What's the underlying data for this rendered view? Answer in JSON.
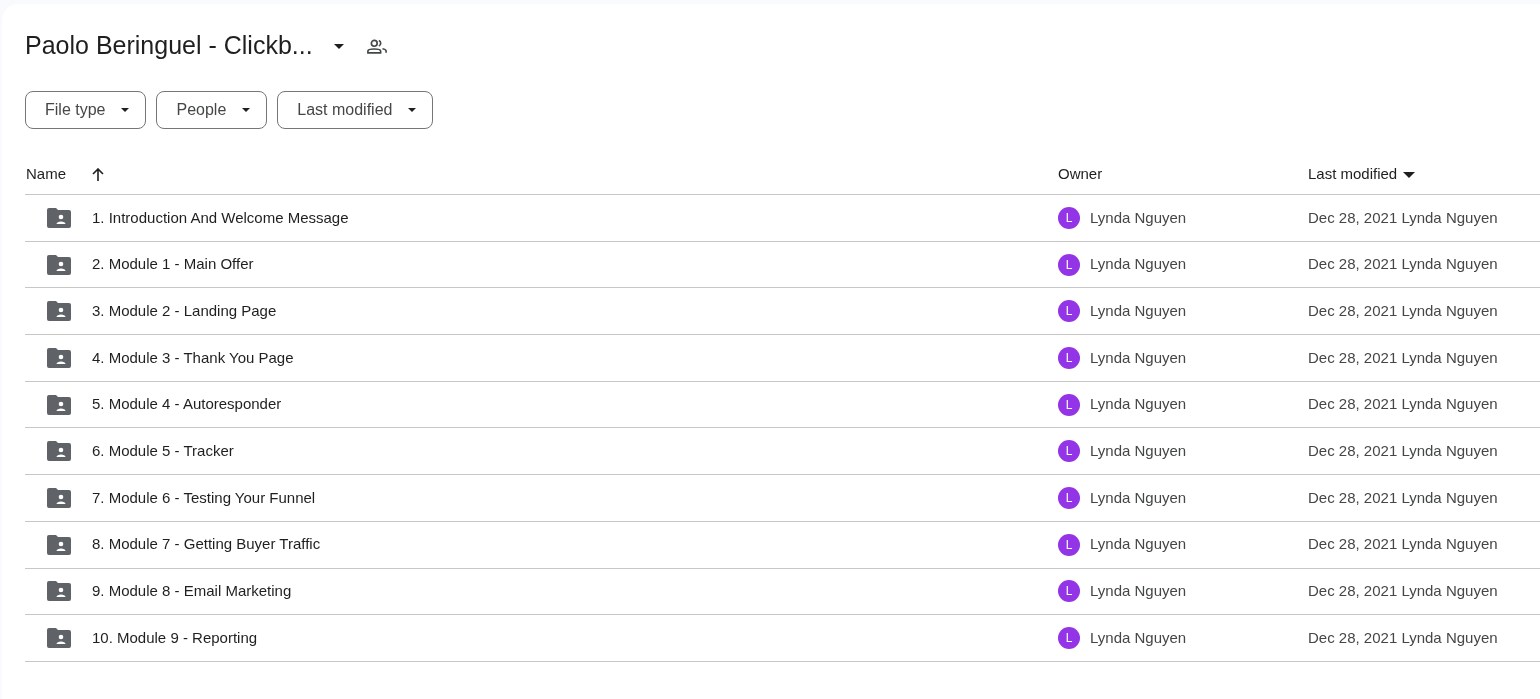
{
  "folder": {
    "title": "Paolo Beringuel - Clickb..."
  },
  "filters": [
    {
      "label": "File type"
    },
    {
      "label": "People"
    },
    {
      "label": "Last modified"
    }
  ],
  "table": {
    "columns": [
      {
        "label": "Name"
      },
      {
        "label": "Owner"
      },
      {
        "label": "Last modified"
      }
    ],
    "rows": [
      {
        "name": "1. Introduction And Welcome Message",
        "owner_initial": "L",
        "owner": "Lynda Nguyen",
        "modified": "Dec 28, 2021 Lynda Nguyen"
      },
      {
        "name": "2. Module 1 - Main Offer",
        "owner_initial": "L",
        "owner": "Lynda Nguyen",
        "modified": "Dec 28, 2021 Lynda Nguyen"
      },
      {
        "name": "3. Module 2 - Landing Page",
        "owner_initial": "L",
        "owner": "Lynda Nguyen",
        "modified": "Dec 28, 2021 Lynda Nguyen"
      },
      {
        "name": "4. Module 3 - Thank You Page",
        "owner_initial": "L",
        "owner": "Lynda Nguyen",
        "modified": "Dec 28, 2021 Lynda Nguyen"
      },
      {
        "name": "5. Module 4 - Autoresponder",
        "owner_initial": "L",
        "owner": "Lynda Nguyen",
        "modified": "Dec 28, 2021 Lynda Nguyen"
      },
      {
        "name": "6. Module 5 - Tracker",
        "owner_initial": "L",
        "owner": "Lynda Nguyen",
        "modified": "Dec 28, 2021 Lynda Nguyen"
      },
      {
        "name": "7. Module 6 - Testing Your Funnel",
        "owner_initial": "L",
        "owner": "Lynda Nguyen",
        "modified": "Dec 28, 2021 Lynda Nguyen"
      },
      {
        "name": "8. Module 7 - Getting Buyer Traffic",
        "owner_initial": "L",
        "owner": "Lynda Nguyen",
        "modified": "Dec 28, 2021 Lynda Nguyen"
      },
      {
        "name": "9. Module 8 - Email Marketing",
        "owner_initial": "L",
        "owner": "Lynda Nguyen",
        "modified": "Dec 28, 2021 Lynda Nguyen"
      },
      {
        "name": "10. Module 9 - Reporting",
        "owner_initial": "L",
        "owner": "Lynda Nguyen",
        "modified": "Dec 28, 2021 Lynda Nguyen"
      }
    ]
  }
}
